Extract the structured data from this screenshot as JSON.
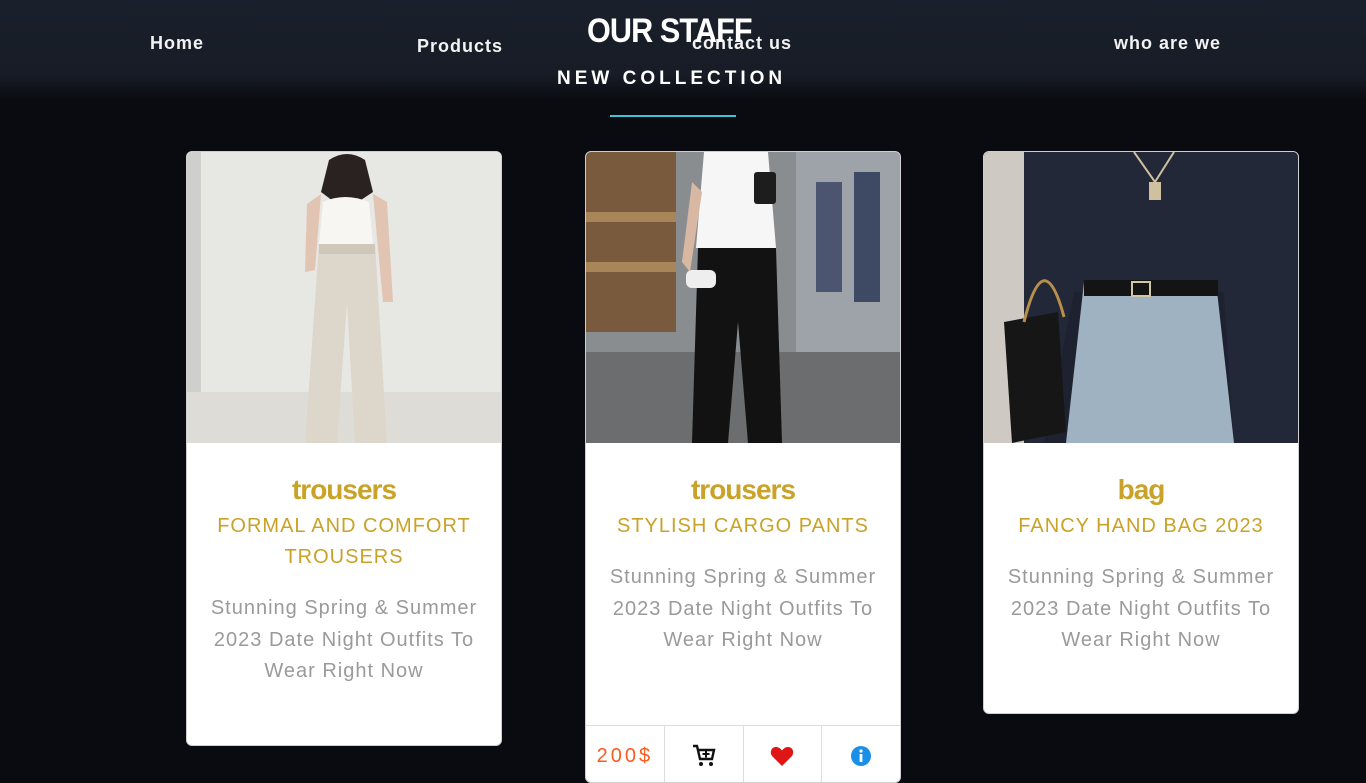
{
  "nav": {
    "home": "Home",
    "products": "Products",
    "contact": "contact us",
    "about": "who are we"
  },
  "header": {
    "title": "OUR STAFF",
    "subtitle": "NEW COLLECTION"
  },
  "cards": [
    {
      "title": "trousers",
      "subtitle": "FORMAL AND COMFORT TROUSERS",
      "description": "Stunning Spring & Summer 2023 Date Night Outfits To Wear Right Now",
      "image_icon": "outfit-photo-icon"
    },
    {
      "title": "trousers",
      "subtitle": "STYLISH CARGO PANTS",
      "description": "Stunning Spring & Summer 2023 Date Night Outfits To Wear Right Now",
      "image_icon": "outfit-photo-icon",
      "price": "200$"
    },
    {
      "title": "bag",
      "subtitle": "FANCY HAND BAG 2023",
      "description": "Stunning Spring & Summer 2023 Date Night Outfits To Wear Right Now",
      "image_icon": "outfit-photo-icon"
    }
  ],
  "actions": {
    "icons": [
      "add-to-cart-icon",
      "heart-icon",
      "info-icon"
    ]
  },
  "colors": {
    "accent_line": "#38c7d6",
    "title_gold": "#c9a227",
    "price_orange": "#ff5a1f",
    "heart_red": "#e01515",
    "info_blue": "#1a8fe8",
    "background": "#090b10",
    "navbar": "#1a202b"
  }
}
